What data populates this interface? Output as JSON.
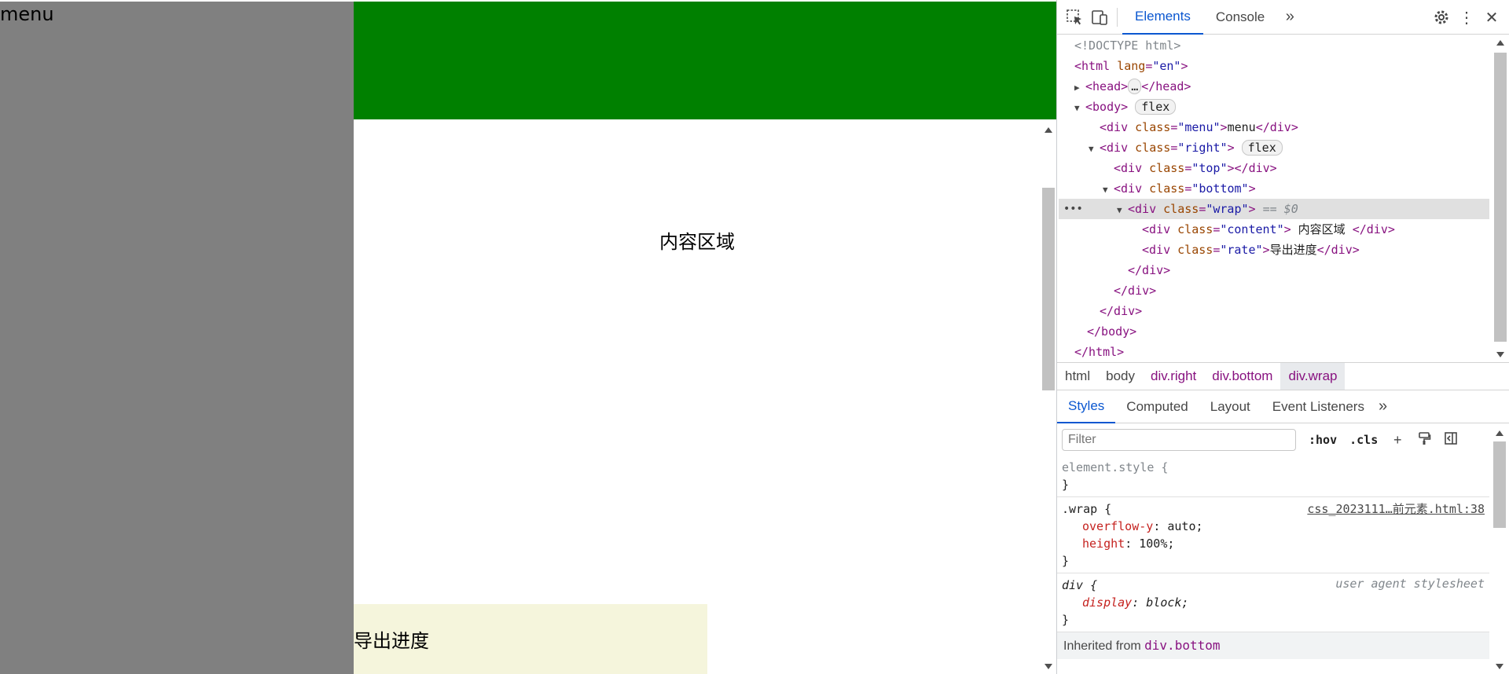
{
  "page": {
    "menu_text": "menu",
    "content_text": "内容区域",
    "rate_text": "导出进度"
  },
  "devtools": {
    "main_tabs": [
      "Elements",
      "Console"
    ],
    "elements": {
      "doctype": "<!DOCTYPE html>",
      "html_open": "<html lang=\"en\">",
      "head": "<head>",
      "head_close": "</head>",
      "body_open": "<body>",
      "flex_badge": "flex",
      "menu_div": "<div class=\"menu\">menu</div>",
      "right_div": "<div class=\"right\">",
      "top_div": "<div class=\"top\"></div>",
      "bottom_div": "<div class=\"bottom\">",
      "wrap_div": "<div class=\"wrap\">",
      "selected_marker": "== $0",
      "content_div": "<div class=\"content\"> 内容区域 </div>",
      "rate_div": "<div class=\"rate\">导出进度</div>",
      "close_div": "</div>",
      "body_close": "</body>",
      "html_close": "</html>"
    },
    "breadcrumbs": [
      "html",
      "body",
      "div.right",
      "div.bottom",
      "div.wrap"
    ],
    "styles_tabs": [
      "Styles",
      "Computed",
      "Layout",
      "Event Listeners"
    ],
    "filter_placeholder": "Filter",
    "filter_buttons": [
      ":hov",
      ".cls"
    ],
    "rules": {
      "element_style": "element.style {",
      "close_brace": "}",
      "wrap_selector": ".wrap {",
      "wrap_source": "css_2023111…前元素.html:38",
      "overflow_prop": "overflow-y",
      "overflow_val": "auto;",
      "height_prop": "height",
      "height_val": "100%;",
      "div_selector": "div {",
      "ua_label": "user agent stylesheet",
      "display_prop": "display",
      "display_val": "block;",
      "inherited_label": "Inherited from ",
      "inherited_from": "div.bottom"
    }
  },
  "colors": {
    "menu": "#808080",
    "top": "#008000",
    "rate": "#f5f5dc",
    "accent": "#0b57d0"
  }
}
